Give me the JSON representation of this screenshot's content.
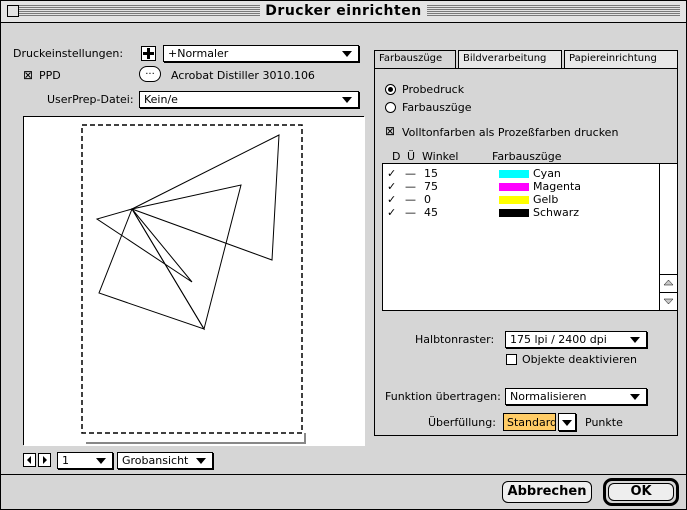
{
  "window": {
    "title": "Drucker einrichten"
  },
  "left": {
    "druckeinstellungen_label": "Druckeinstellungen:",
    "druckeinstellungen_value": "+Normaler",
    "ppd_label": "PPD",
    "ppd_checkbox_mark": "⊠",
    "ppd_name": "Acrobat Distiller 3010.106",
    "ppd_button_label": "...",
    "userprep_label": "UserPrep-Datei:",
    "userprep_value": "Kein/e",
    "page_value": "1",
    "view_value": "Grobansicht"
  },
  "tabs": [
    {
      "label": "Farbauszüge",
      "active": true
    },
    {
      "label": "Bildverarbeitung",
      "active": false
    },
    {
      "label": "Papiereinrichtung",
      "active": false
    }
  ],
  "options": {
    "probedruck": "Probedruck",
    "farbauszuege": "Farbauszüge",
    "volltonfarben": "Volltonfarben als Prozeßfarben drucken",
    "volltonfarben_mark": "⊠"
  },
  "list": {
    "header_d": "D",
    "header_u": "Ü",
    "header_winkel": "Winkel",
    "header_farbauszuege": "Farbauszüge",
    "rows": [
      {
        "check": "✓",
        "dash": "—",
        "angle": "15",
        "name": "Cyan",
        "color": "#00ffff"
      },
      {
        "check": "✓",
        "dash": "—",
        "angle": "75",
        "name": "Magenta",
        "color": "#ff00ff"
      },
      {
        "check": "✓",
        "dash": "—",
        "angle": "0",
        "name": "Gelb",
        "color": "#ffff00"
      },
      {
        "check": "✓",
        "dash": "—",
        "angle": "45",
        "name": "Schwarz",
        "color": "#000000"
      }
    ]
  },
  "halbton": {
    "label": "Halbtonraster:",
    "value": "175 lpi / 2400 dpi",
    "objekte_label": "Objekte deaktivieren"
  },
  "funktion": {
    "label": "Funktion übertragen:",
    "value": "Normalisieren"
  },
  "ueberfuellung": {
    "label": "Überfüllung:",
    "value": "Standard",
    "unit": "Punkte",
    "highlight_color": "#ffcc66"
  },
  "buttons": {
    "cancel": "Abbrechen",
    "ok": "OK"
  },
  "icons": {
    "add": "plus-icon",
    "prev": "page-prev-icon",
    "next": "page-next-icon"
  }
}
